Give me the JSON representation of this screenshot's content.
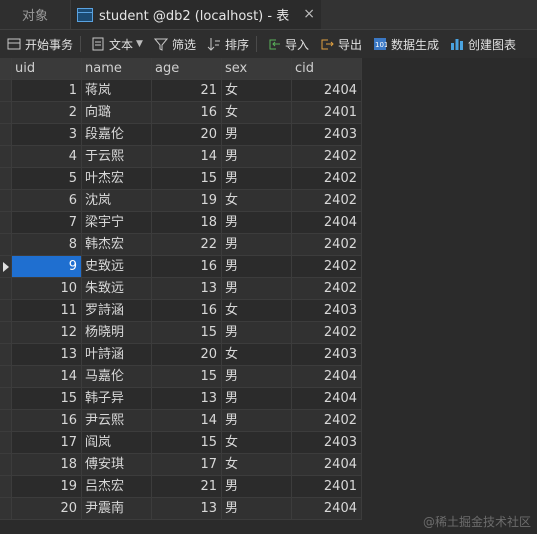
{
  "tabs": [
    {
      "label": "对象"
    },
    {
      "label": "student @db2 (localhost) - 表"
    }
  ],
  "toolbar": {
    "begin_tx": "开始事务",
    "text": "文本",
    "filter": "筛选",
    "sort": "排序",
    "import": "导入",
    "export": "导出",
    "generate": "数据生成",
    "chart": "创建图表"
  },
  "columns": [
    "uid",
    "name",
    "age",
    "sex",
    "cid"
  ],
  "selected_row_index": 8,
  "rows": [
    {
      "uid": "1",
      "name": "蒋岚",
      "age": "21",
      "sex": "女",
      "cid": "2404"
    },
    {
      "uid": "2",
      "name": "向璐",
      "age": "16",
      "sex": "女",
      "cid": "2401"
    },
    {
      "uid": "3",
      "name": "段嘉伦",
      "age": "20",
      "sex": "男",
      "cid": "2403"
    },
    {
      "uid": "4",
      "name": "于云熙",
      "age": "14",
      "sex": "男",
      "cid": "2402"
    },
    {
      "uid": "5",
      "name": "叶杰宏",
      "age": "15",
      "sex": "男",
      "cid": "2402"
    },
    {
      "uid": "6",
      "name": "沈岚",
      "age": "19",
      "sex": "女",
      "cid": "2402"
    },
    {
      "uid": "7",
      "name": "梁宇宁",
      "age": "18",
      "sex": "男",
      "cid": "2404"
    },
    {
      "uid": "8",
      "name": "韩杰宏",
      "age": "22",
      "sex": "男",
      "cid": "2402"
    },
    {
      "uid": "9",
      "name": "史致远",
      "age": "16",
      "sex": "男",
      "cid": "2402"
    },
    {
      "uid": "10",
      "name": "朱致远",
      "age": "13",
      "sex": "男",
      "cid": "2402"
    },
    {
      "uid": "11",
      "name": "罗詩涵",
      "age": "16",
      "sex": "女",
      "cid": "2403"
    },
    {
      "uid": "12",
      "name": "杨晓明",
      "age": "15",
      "sex": "男",
      "cid": "2402"
    },
    {
      "uid": "13",
      "name": "叶詩涵",
      "age": "20",
      "sex": "女",
      "cid": "2403"
    },
    {
      "uid": "14",
      "name": "马嘉伦",
      "age": "15",
      "sex": "男",
      "cid": "2404"
    },
    {
      "uid": "15",
      "name": "韩子异",
      "age": "13",
      "sex": "男",
      "cid": "2404"
    },
    {
      "uid": "16",
      "name": "尹云熙",
      "age": "14",
      "sex": "男",
      "cid": "2402"
    },
    {
      "uid": "17",
      "name": "阎岚",
      "age": "15",
      "sex": "女",
      "cid": "2403"
    },
    {
      "uid": "18",
      "name": "傅安琪",
      "age": "17",
      "sex": "女",
      "cid": "2404"
    },
    {
      "uid": "19",
      "name": "吕杰宏",
      "age": "21",
      "sex": "男",
      "cid": "2401"
    },
    {
      "uid": "20",
      "name": "尹震南",
      "age": "13",
      "sex": "男",
      "cid": "2404"
    }
  ],
  "watermark": "@稀土掘金技术社区",
  "colors": {
    "accent": "#1f6fd0",
    "bg": "#2b2b2b"
  }
}
